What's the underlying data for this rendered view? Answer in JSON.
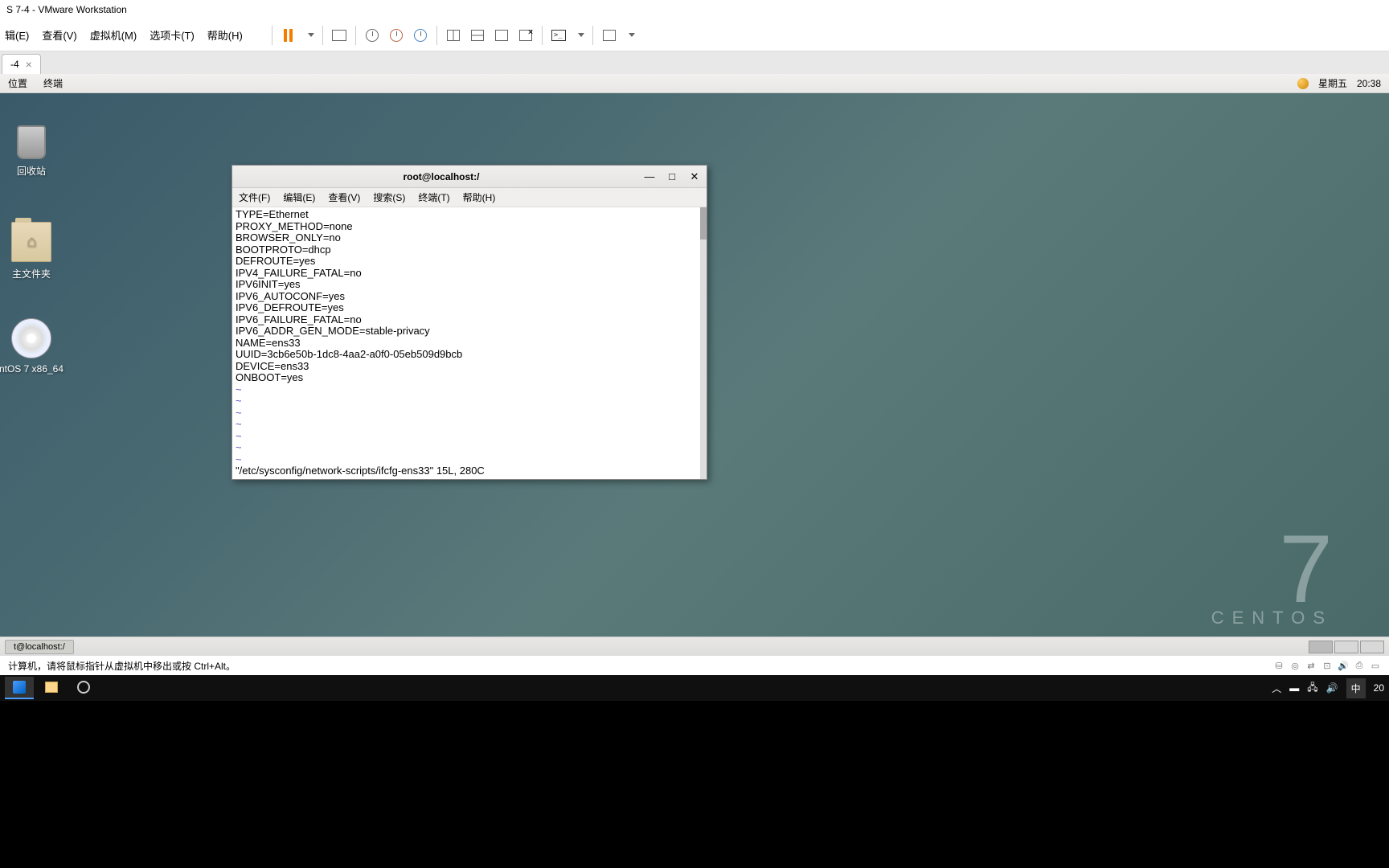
{
  "win_title": "S 7-4 - VMware Workstation",
  "vmware_menu": {
    "edit": "辑(E)",
    "view": "查看(V)",
    "vm": "虚拟机(M)",
    "tabs": "选项卡(T)",
    "help": "帮助(H)"
  },
  "vmware_tab": {
    "label": "-4",
    "close": "×"
  },
  "gnome_top": {
    "places": "位置",
    "terminal": "终端",
    "day": "星期五",
    "time": "20:38"
  },
  "desktop_icons": {
    "trash": "回收站",
    "home": "主文件夹",
    "disc": "ntOS 7 x86_64"
  },
  "centos_brand": {
    "seven": "7",
    "name": "CENTOS"
  },
  "terminal": {
    "title": "root@localhost:/",
    "menu": {
      "file": "文件(F)",
      "edit": "编辑(E)",
      "view": "查看(V)",
      "search": "搜索(S)",
      "terminal": "终端(T)",
      "help": "帮助(H)"
    },
    "lines": [
      "TYPE=Ethernet",
      "PROXY_METHOD=none",
      "BROWSER_ONLY=no",
      "BOOTPROTO=dhcp",
      "DEFROUTE=yes",
      "IPV4_FAILURE_FATAL=no",
      "IPV6INIT=yes",
      "IPV6_AUTOCONF=yes",
      "IPV6_DEFROUTE=yes",
      "IPV6_FAILURE_FATAL=no",
      "IPV6_ADDR_GEN_MODE=stable-privacy",
      "NAME=ens33",
      "UUID=3cb6e50b-1dc8-4aa2-a0f0-05eb509d9bcb",
      "DEVICE=ens33",
      "ONBOOT=yes"
    ],
    "tilde": "~",
    "status": "\"/etc/sysconfig/network-scripts/ifcfg-ens33\" 15L, 280C"
  },
  "gnome_bottom": {
    "task": "t@localhost:/"
  },
  "vmware_status": "计算机，请将鼠标指针从虚拟机中移出或按 Ctrl+Alt。",
  "win_taskbar": {
    "ime": "中",
    "time": "20"
  }
}
